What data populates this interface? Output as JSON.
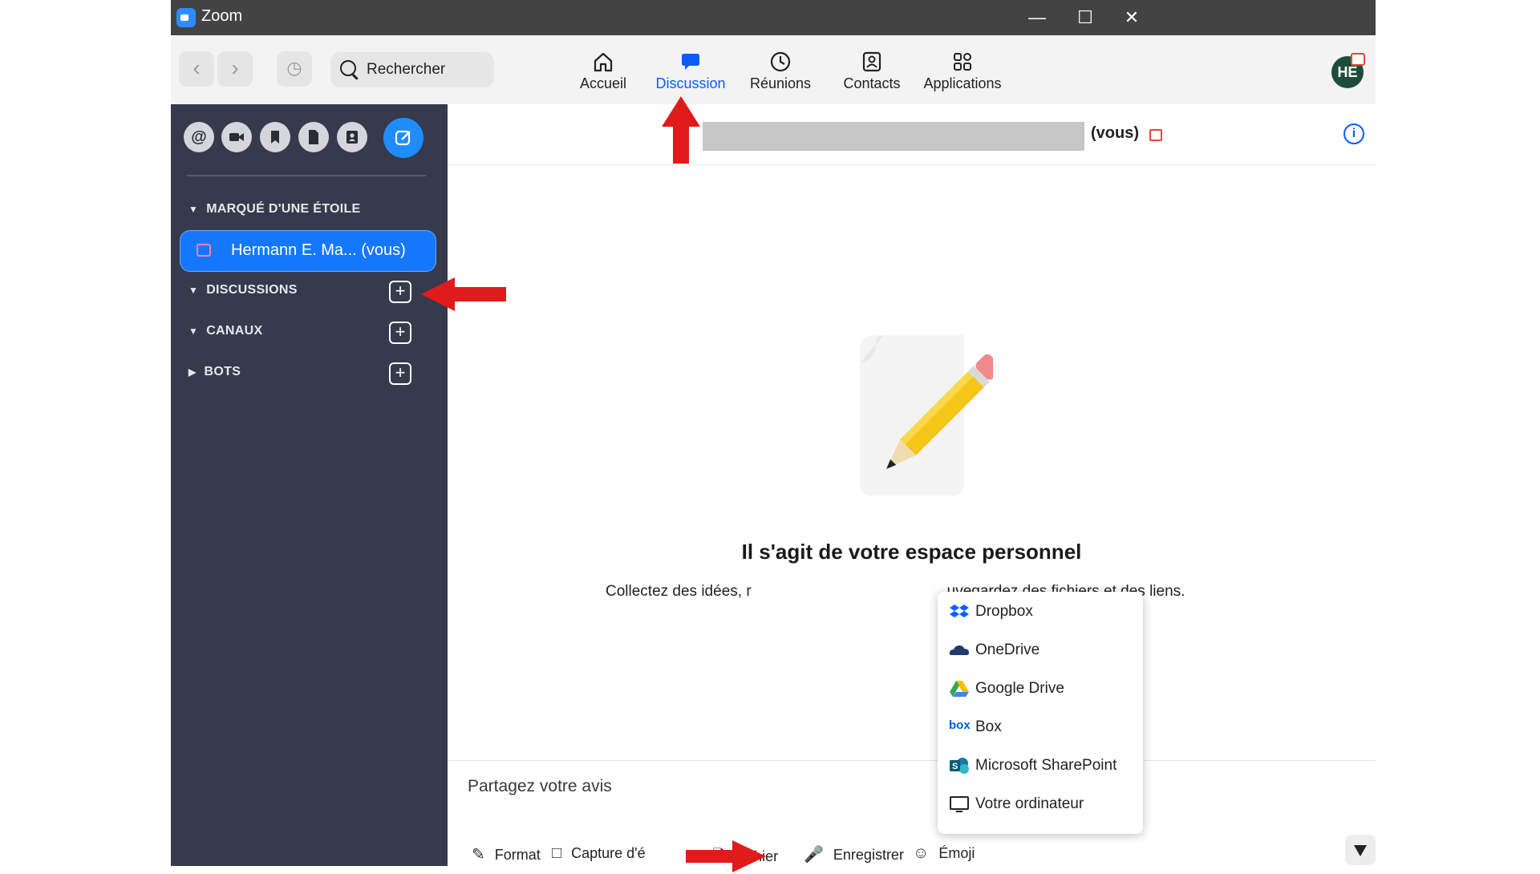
{
  "window": {
    "title": "Zoom",
    "controls": [
      "minimize",
      "maximize",
      "close"
    ]
  },
  "toolbar": {
    "back_icon": "chevron-left-icon",
    "forward_icon": "chevron-right-icon",
    "history_icon": "history-icon",
    "search_placeholder": "Rechercher",
    "tabs": [
      {
        "label": "Accueil",
        "icon": "home-icon",
        "active": false
      },
      {
        "label": "Discussion",
        "icon": "chat-bubble-icon",
        "active": true
      },
      {
        "label": "Réunions",
        "icon": "clock-icon",
        "active": false
      },
      {
        "label": "Contacts",
        "icon": "contact-card-icon",
        "active": false
      },
      {
        "label": "Applications",
        "icon": "apps-icon",
        "active": false
      }
    ],
    "avatar_initials": "HE"
  },
  "sidebar": {
    "icons": [
      "mention-icon",
      "video-icon",
      "bookmark-icon",
      "file-icon",
      "contact-icon",
      "compose-icon"
    ],
    "sections": {
      "starred": "MARQUÉ D'UNE ÉTOILE",
      "discussions": "DISCUSSIONS",
      "channels": "CANAUX",
      "bots": "BOTS"
    },
    "starred_item": "Hermann E. Ma... (vous)"
  },
  "chat": {
    "header_suffix": "(vous)",
    "empty_title": "Il s'agit de votre espace personnel",
    "empty_desc_left": "Collectez des idées, r",
    "empty_desc_right": "uvegardez des fichiers et des liens.",
    "composer_placeholder": "Partagez votre avis",
    "tools": {
      "format": "Format",
      "capture": "Capture d'é",
      "file": "Fichier",
      "record": "Enregistrer",
      "emoji": "Émoji"
    }
  },
  "file_menu": {
    "items": [
      {
        "label": "Dropbox",
        "icon": "dropbox-icon"
      },
      {
        "label": "OneDrive",
        "icon": "onedrive-icon"
      },
      {
        "label": "Google Drive",
        "icon": "google-drive-icon"
      },
      {
        "label": "Box",
        "icon": "box-icon"
      },
      {
        "label": "Microsoft SharePoint",
        "icon": "sharepoint-icon"
      },
      {
        "label": "Votre ordinateur",
        "icon": "computer-icon"
      }
    ]
  },
  "colors": {
    "accent": "#0b5cff",
    "sidebar_bg": "#363a4c",
    "arrow_red": "#e01b1b"
  }
}
